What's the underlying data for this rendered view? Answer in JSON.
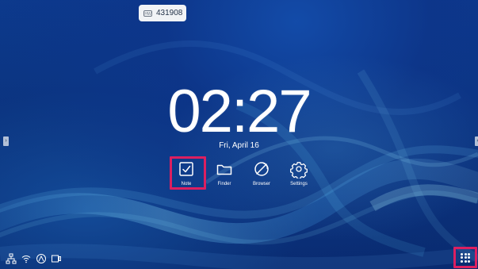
{
  "top_badge": {
    "icon_name": "room-code-icon",
    "icon_text": "HW",
    "code": "431908"
  },
  "clock": {
    "time": "02:27",
    "date": "Fri, April 16"
  },
  "apps": [
    {
      "label": "Note",
      "icon": "note-icon"
    },
    {
      "label": "Finder",
      "icon": "folder-icon"
    },
    {
      "label": "Browser",
      "icon": "browser-icon"
    },
    {
      "label": "Settings",
      "icon": "settings-icon"
    }
  ],
  "status_bar": {
    "icons": [
      "network-icon",
      "wifi-icon",
      "assistant-icon",
      "screen-share-icon"
    ]
  },
  "apps_launcher": {
    "icon": "app-grid-icon"
  },
  "side_handles": {
    "left_icon": "left-edge-handle-icon",
    "right_icon": "right-edge-handle-icon"
  },
  "colors": {
    "highlight": "#dc1f60",
    "background_primary": "#0b347f",
    "text": "#ffffff",
    "badge_background": "#f1f3f6"
  }
}
